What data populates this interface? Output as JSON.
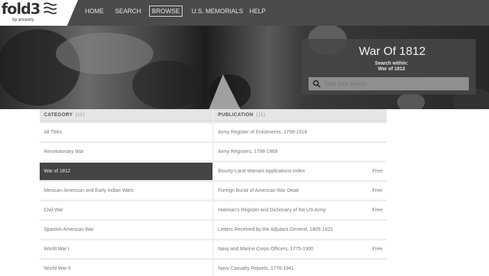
{
  "logo": {
    "text": "fold3",
    "sub": "by ancestry"
  },
  "nav": {
    "items": [
      {
        "label": "HOME"
      },
      {
        "label": "SEARCH"
      },
      {
        "label": "BROWSE",
        "active": true
      },
      {
        "label": "U.S. MEMORIALS"
      },
      {
        "label": "HELP"
      }
    ]
  },
  "hero": {
    "title": "War Of 1812",
    "search_within_label": "Search within:",
    "search_within_value": "War of 1812",
    "search_placeholder": "Type your search"
  },
  "category": {
    "header": "CATEGORY",
    "count": "(11)",
    "items": [
      {
        "label": "All Titles"
      },
      {
        "label": "Revolutionary War"
      },
      {
        "label": "War of 1812",
        "selected": true
      },
      {
        "label": "Mexican-American and Early Indian Wars"
      },
      {
        "label": "Civil War"
      },
      {
        "label": "Spanish-American War"
      },
      {
        "label": "World War I"
      },
      {
        "label": "World War II"
      }
    ]
  },
  "publication": {
    "header": "PUBLICATION",
    "count": "(11)",
    "items": [
      {
        "label": "Army Register of Enlistments, 1798-1914",
        "badge": ""
      },
      {
        "label": "Army Registers, 1798-1969",
        "badge": ""
      },
      {
        "label": "Bounty-Land Warrant Applications Index",
        "badge": "Free"
      },
      {
        "label": "Foreign Burial of American War Dead",
        "badge": "Free"
      },
      {
        "label": "Hatiman's Register and Dictionary of the US Army",
        "badge": "Free"
      },
      {
        "label": "Letters Received by the Adjutant General, 1805-1821",
        "badge": ""
      },
      {
        "label": "Navy and Marine Corps Officers, 1775-1900",
        "badge": "Free"
      },
      {
        "label": "Navy Casualty Reports, 1776-1941",
        "badge": ""
      }
    ]
  },
  "colors": {
    "nav_bg": "#4a4a4a",
    "selected_row": "#444444",
    "panel_bg": "#464646"
  }
}
